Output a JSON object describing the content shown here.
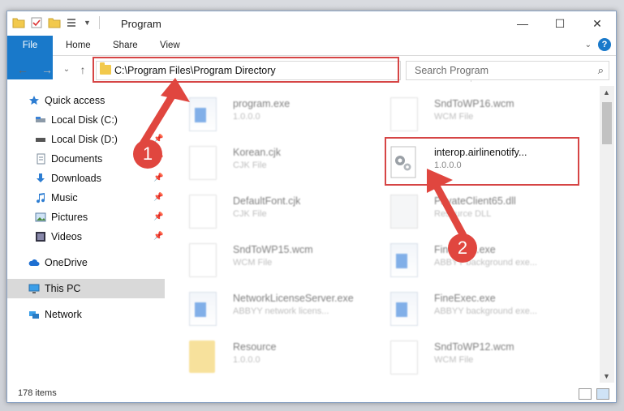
{
  "window": {
    "title": "Program",
    "controls": {
      "minimize": "—",
      "maximize": "☐",
      "close": "✕"
    }
  },
  "ribbon": {
    "tabs": [
      {
        "label": "File"
      },
      {
        "label": "Home"
      },
      {
        "label": "Share"
      },
      {
        "label": "View"
      }
    ],
    "help": "?"
  },
  "address": {
    "path": "C:\\Program Files\\Program Directory",
    "dropdown": "⌄",
    "refresh": "↻"
  },
  "search": {
    "placeholder": "Search Program",
    "icon": "⌕"
  },
  "nav": {
    "back": "←",
    "forward": "→",
    "recent": "⌄",
    "up": "↑"
  },
  "sidebar": {
    "items": [
      {
        "label": "Quick access",
        "icon": "star-icon"
      },
      {
        "label": "Local Disk (C:)",
        "icon": "drive-icon"
      },
      {
        "label": "Local Disk (D:)",
        "icon": "drive-icon"
      },
      {
        "label": "Documents",
        "icon": "documents-icon"
      },
      {
        "label": "Downloads",
        "icon": "download-icon"
      },
      {
        "label": "Music",
        "icon": "music-icon"
      },
      {
        "label": "Pictures",
        "icon": "pictures-icon"
      },
      {
        "label": "Videos",
        "icon": "videos-icon"
      },
      {
        "label": "OneDrive",
        "icon": "cloud-icon"
      },
      {
        "label": "This PC",
        "icon": "computer-icon"
      },
      {
        "label": "Network",
        "icon": "network-icon"
      }
    ],
    "pin": "📌"
  },
  "files": [
    {
      "name": "program.exe",
      "sub": "1.0.0.0",
      "type": "exe",
      "highlighted": false
    },
    {
      "name": "SndToWP16.wcm",
      "sub": "WCM File",
      "type": "doc",
      "highlighted": false
    },
    {
      "name": "Korean.cjk",
      "sub": "CJK File",
      "type": "doc",
      "highlighted": false
    },
    {
      "name": "interop.airlinenotify...",
      "sub": "1.0.0.0",
      "type": "dll",
      "highlighted": true
    },
    {
      "name": "DefaultFont.cjk",
      "sub": "CJK File",
      "type": "doc",
      "highlighted": false
    },
    {
      "name": "PrivateClient65.dll",
      "sub": "Resource DLL",
      "type": "dll",
      "highlighted": false
    },
    {
      "name": "SndToWP15.wcm",
      "sub": "WCM File",
      "type": "doc",
      "highlighted": false
    },
    {
      "name": "FineExec.exe",
      "sub": "ABBYY background exe...",
      "type": "exe",
      "highlighted": false
    },
    {
      "name": "NetworkLicenseServer.exe",
      "sub": "ABBYY network licens...",
      "type": "exe",
      "highlighted": false
    },
    {
      "name": "FineExec.exe",
      "sub": "ABBYY background exe...",
      "type": "exe",
      "highlighted": false
    },
    {
      "name": "Resource",
      "sub": "1.0.0.0",
      "type": "folder",
      "highlighted": false
    },
    {
      "name": "SndToWP12.wcm",
      "sub": "WCM File",
      "type": "doc",
      "highlighted": false
    }
  ],
  "status": {
    "items_count": "178 items"
  },
  "annotations": {
    "step1": "1",
    "step2": "2",
    "accent_color": "#e0463f"
  }
}
